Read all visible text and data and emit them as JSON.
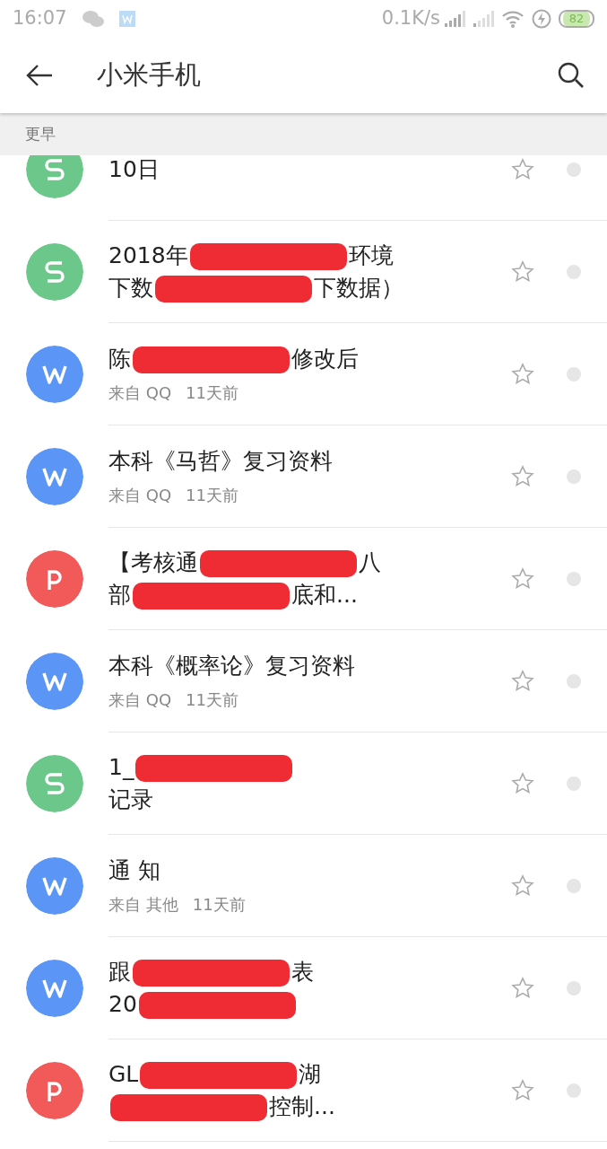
{
  "status_bar": {
    "time": "16:07",
    "speed": "0.1K/s",
    "battery": "82"
  },
  "toolbar": {
    "title": "小米手机"
  },
  "section": {
    "label": "更早"
  },
  "files": [
    {
      "kind": "sheet",
      "lines": [
        [
          {
            "text": "10日"
          }
        ]
      ],
      "starred": false
    },
    {
      "kind": "sheet",
      "lines": [
        [
          {
            "text": "2018年"
          },
          {
            "kind": "redaction"
          },
          {
            "text": "环境"
          }
        ],
        [
          {
            "text": "下数"
          },
          {
            "kind": "redaction"
          },
          {
            "text": "下数据）"
          }
        ]
      ],
      "starred": false
    },
    {
      "kind": "doc",
      "lines": [
        [
          {
            "text": "陈"
          },
          {
            "kind": "redaction"
          },
          {
            "text": "修改后"
          }
        ]
      ],
      "source": "来自 QQ",
      "time": "11天前",
      "starred": false
    },
    {
      "kind": "doc",
      "lines": [
        [
          {
            "text": "本科《马哲》复习资料"
          }
        ]
      ],
      "source": "来自 QQ",
      "time": "11天前",
      "starred": false
    },
    {
      "kind": "slides",
      "lines": [
        [
          {
            "text": "【考核通"
          },
          {
            "kind": "redaction"
          },
          {
            "text": "八"
          }
        ],
        [
          {
            "text": "部"
          },
          {
            "kind": "redaction"
          },
          {
            "text": "底和..."
          }
        ]
      ],
      "starred": false
    },
    {
      "kind": "doc",
      "lines": [
        [
          {
            "text": "本科《概率论》复习资料"
          }
        ]
      ],
      "source": "来自 QQ",
      "time": "11天前",
      "starred": false
    },
    {
      "kind": "sheet",
      "lines": [
        [
          {
            "text": "1_"
          },
          {
            "kind": "redaction"
          }
        ],
        [
          {
            "text": "记录"
          }
        ]
      ],
      "starred": false
    },
    {
      "kind": "doc",
      "lines": [
        [
          {
            "text": "通  知"
          }
        ]
      ],
      "source": "来自 其他",
      "time": "11天前",
      "starred": false
    },
    {
      "kind": "doc",
      "lines": [
        [
          {
            "text": "跟"
          },
          {
            "kind": "redaction"
          },
          {
            "text": "表"
          }
        ],
        [
          {
            "text": "20"
          },
          {
            "kind": "redaction"
          }
        ]
      ],
      "starred": false
    },
    {
      "kind": "slides",
      "lines": [
        [
          {
            "text": "GL"
          },
          {
            "kind": "redaction"
          },
          {
            "text": "湖"
          }
        ],
        [
          {
            "kind": "redaction"
          },
          {
            "text": "控制..."
          }
        ]
      ],
      "starred": false
    }
  ]
}
